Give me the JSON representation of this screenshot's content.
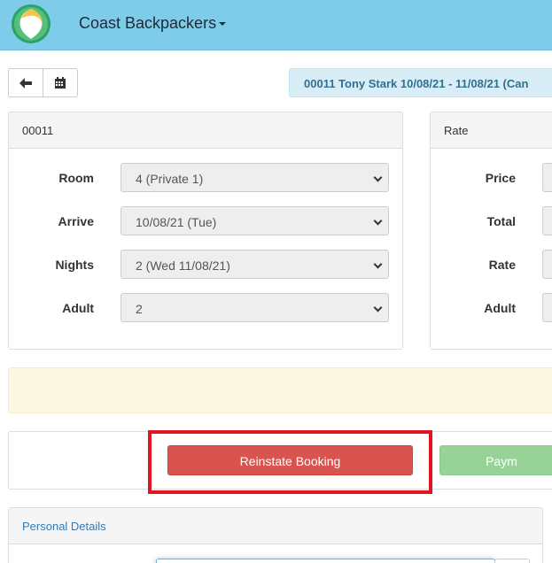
{
  "navbar": {
    "brand": "Coast Backpackers",
    "logo_icon": "circle-leaf-logo"
  },
  "toolbar": {
    "back_icon": "arrow-left-icon",
    "calendar_icon": "calendar-icon"
  },
  "booking_summary": "00011  Tony Stark  10/08/21 - 11/08/21  (Can",
  "booking_panel": {
    "title": "00011",
    "fields": [
      {
        "label": "Room",
        "value": "4 (Private 1)"
      },
      {
        "label": "Arrive",
        "value": "10/08/21  (Tue)"
      },
      {
        "label": "Nights",
        "value": "2  (Wed 11/08/21)"
      },
      {
        "label": "Adult",
        "value": "2"
      }
    ]
  },
  "rate_panel": {
    "title": "Rate",
    "fields": [
      {
        "label": "Price"
      },
      {
        "label": "Total"
      },
      {
        "label": "Rate"
      },
      {
        "label": "Adult"
      }
    ]
  },
  "actions": {
    "reinstate_label": "Reinstate Booking",
    "payment_label": "Paym"
  },
  "personal_details": {
    "title": "Personal Details"
  },
  "colors": {
    "navbar": "#7ecbea",
    "danger": "#d9534f",
    "success": "#97d397",
    "highlight": "#e0151f"
  }
}
